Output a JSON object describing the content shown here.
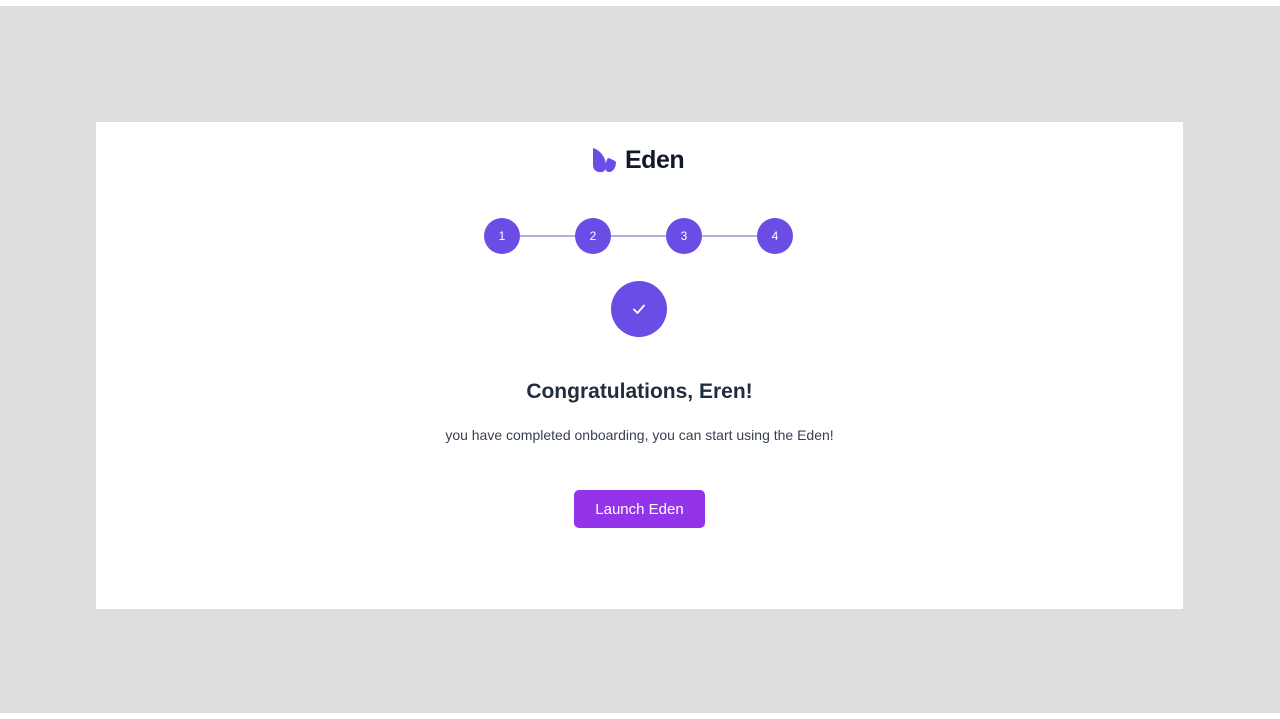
{
  "brand": {
    "name": "Eden",
    "accent_color": "#6b4de6",
    "logo_icon": "eden-leaf-icon"
  },
  "stepper": {
    "steps": [
      {
        "label": "1"
      },
      {
        "label": "2"
      },
      {
        "label": "3"
      },
      {
        "label": "4"
      }
    ],
    "completed_icon": "checkmark-icon"
  },
  "completion": {
    "title": "Congratulations, Eren!",
    "message": "you have completed onboarding, you can start using the Eden!"
  },
  "actions": {
    "launch_label": "Launch Eden",
    "launch_color": "#9333ea"
  }
}
